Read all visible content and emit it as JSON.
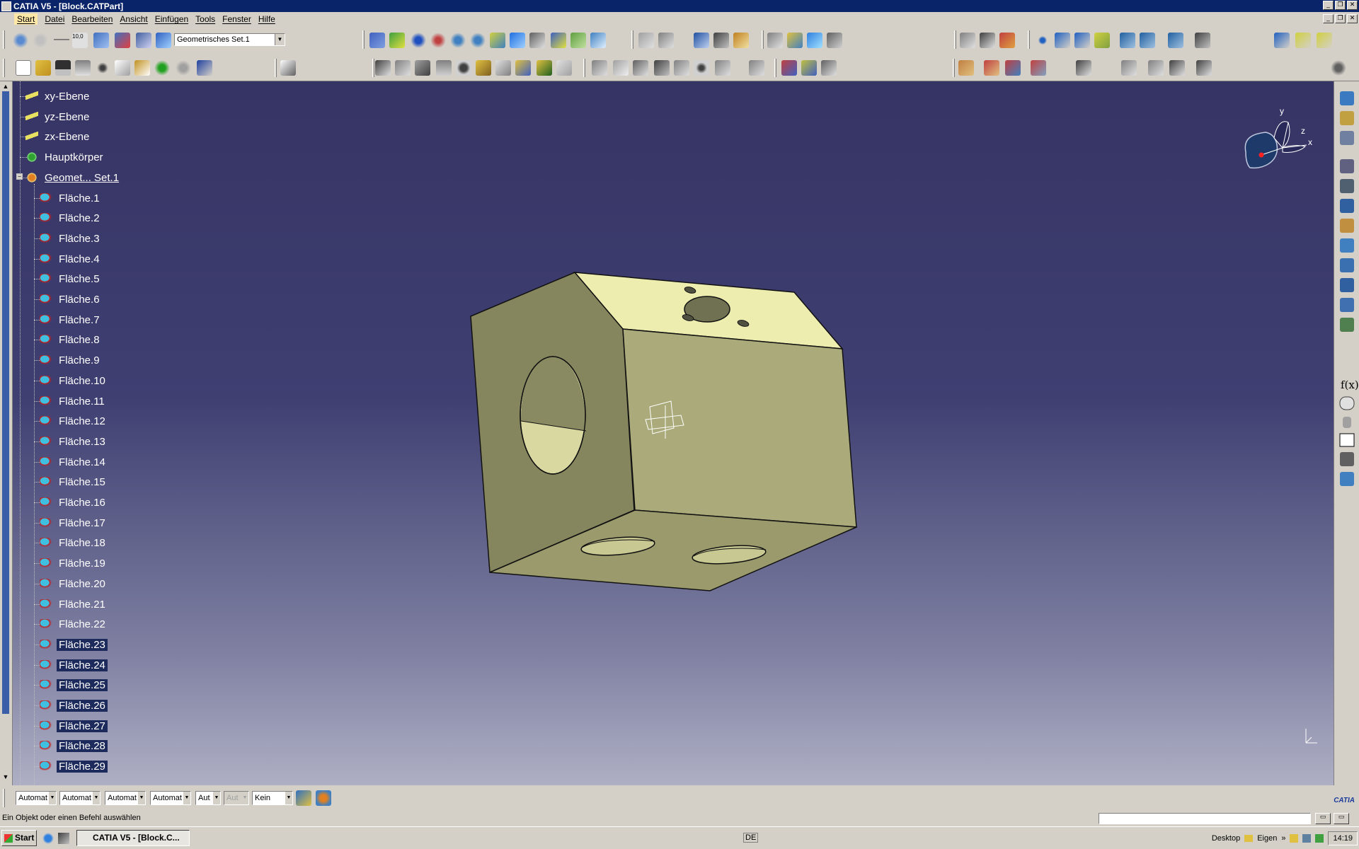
{
  "window": {
    "title": "CATIA V5 - [Block.CATPart]"
  },
  "menu": [
    "Start",
    "Datei",
    "Bearbeiten",
    "Ansicht",
    "Einfügen",
    "Tools",
    "Fenster",
    "Hilfe"
  ],
  "toolbar": {
    "geometric_set": "Geometrisches Set.1"
  },
  "tree": {
    "items": [
      "xy-Ebene",
      "yz-Ebene",
      "zx-Ebene",
      "Hauptkörper",
      "Geomet... Set.1",
      "Fläche.1",
      "Fläche.2",
      "Fläche.3",
      "Fläche.4",
      "Fläche.5",
      "Fläche.6",
      "Fläche.7",
      "Fläche.8",
      "Fläche.9",
      "Fläche.10",
      "Fläche.11",
      "Fläche.12",
      "Fläche.13",
      "Fläche.14",
      "Fläche.15",
      "Fläche.16",
      "Fläche.17",
      "Fläche.18",
      "Fläche.19",
      "Fläche.20",
      "Fläche.21",
      "Fläche.22",
      "Fläche.23",
      "Fläche.24",
      "Fläche.25",
      "Fläche.26",
      "Fläche.27",
      "Fläche.28",
      "Fläche.29"
    ]
  },
  "compass": {
    "x": "x",
    "y": "y",
    "z": "z"
  },
  "props": {
    "color": "Automat",
    "transparency": "Automat",
    "line_thickness": "Automat",
    "line_type": "Automat",
    "point_type": "Aut",
    "disabled": "Aut",
    "layer": "Kein"
  },
  "status": {
    "message": "Ein Objekt oder einen Befehl auswählen"
  },
  "taskbar": {
    "start": "Start",
    "task": "CATIA V5 - [Block.C...",
    "lang": "DE",
    "desktop": "Desktop",
    "eigen": "Eigen",
    "clock": "14:19"
  },
  "colors": {
    "part": "#d8d8a0",
    "background_top": "#363464",
    "background_bottom": "#aeafc4",
    "selection": "#1c2a5c"
  }
}
